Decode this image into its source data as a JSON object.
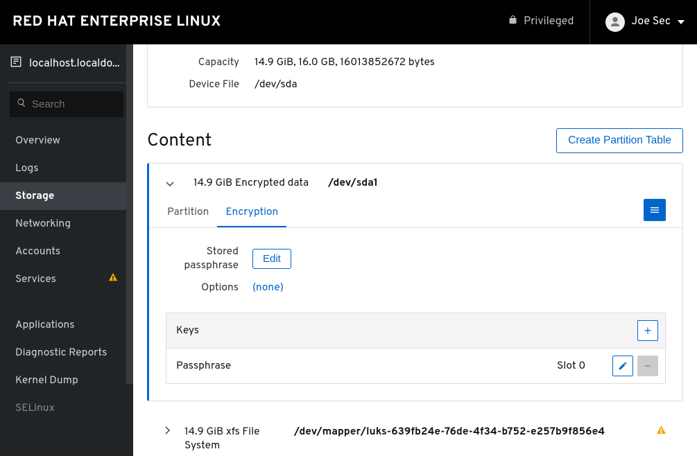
{
  "header": {
    "brand": "RED HAT ENTERPRISE LINUX",
    "privileged": "Privileged",
    "user": "Joe Sec"
  },
  "sidebar": {
    "host": "localhost.localdo...",
    "search_placeholder": "Search",
    "items": [
      {
        "label": "Overview",
        "active": false
      },
      {
        "label": "Logs",
        "active": false
      },
      {
        "label": "Storage",
        "active": true
      },
      {
        "label": "Networking",
        "active": false
      },
      {
        "label": "Accounts",
        "active": false
      },
      {
        "label": "Services",
        "active": false,
        "warn": true
      }
    ],
    "items2": [
      {
        "label": "Applications"
      },
      {
        "label": "Diagnostic Reports"
      },
      {
        "label": "Kernel Dump"
      },
      {
        "label": "SELinux"
      }
    ]
  },
  "drive": {
    "capacity_label": "Capacity",
    "capacity_value": "14.9 GiB, 16.0 GB, 16013852672 bytes",
    "device_label": "Device File",
    "device_value": "/dev/sda"
  },
  "content": {
    "title": "Content",
    "create_btn": "Create Partition Table",
    "partition1": {
      "size_desc": "14.9 GiB Encrypted data",
      "device": "/dev/sda1"
    },
    "tabs": {
      "partition": "Partition",
      "encryption": "Encryption"
    },
    "stored": {
      "label": "Stored passphrase",
      "edit": "Edit"
    },
    "options": {
      "label": "Options",
      "value": "(none)"
    },
    "keys": {
      "header": "Keys",
      "row_type": "Passphrase",
      "row_slot": "Slot 0"
    },
    "partition2": {
      "size_desc": "14.9 GiB xfs File System",
      "device": "/dev/mapper/luks-639fb24e-76de-4f34-b752-e257b9f856e4"
    }
  }
}
